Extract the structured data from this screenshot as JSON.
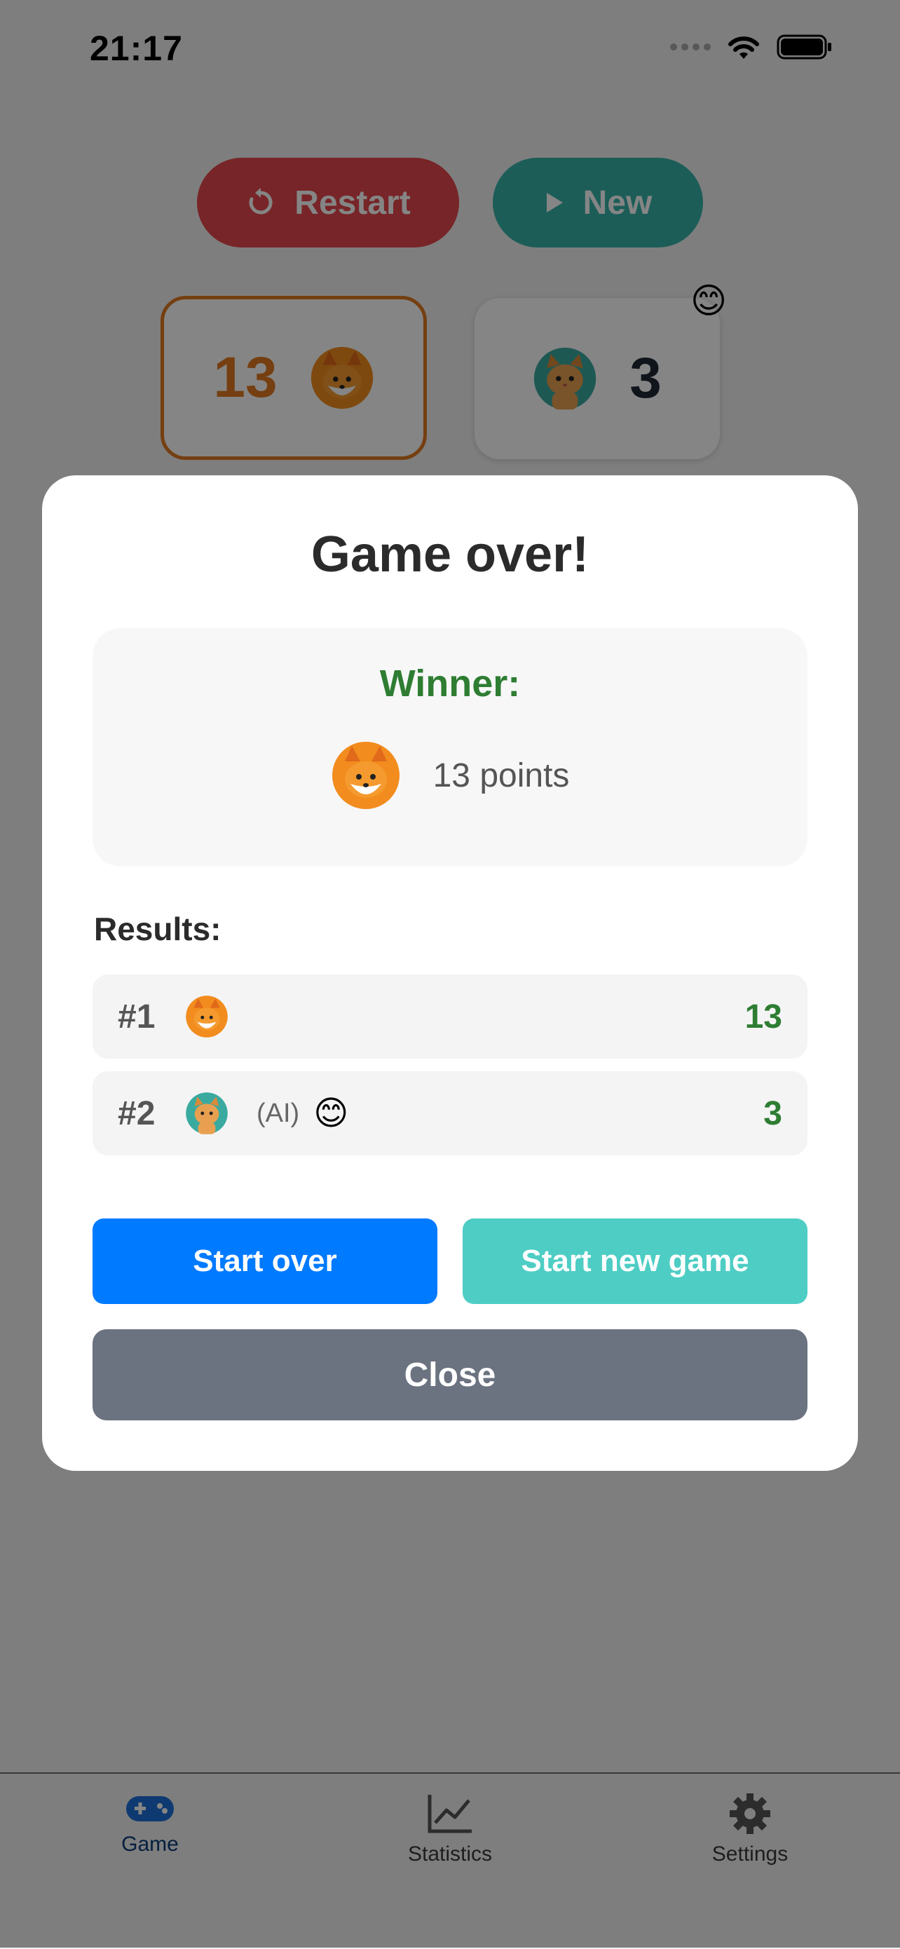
{
  "status_bar": {
    "time": "21:17"
  },
  "toolbar": {
    "restart_label": "Restart",
    "new_label": "New"
  },
  "scoreboard": {
    "player1": {
      "score": "13",
      "avatar": "fox-avatar"
    },
    "player2": {
      "score": "3",
      "avatar": "cat-avatar",
      "mood_emoji": "😊"
    }
  },
  "modal": {
    "title": "Game over!",
    "winner_label": "Winner:",
    "winner_points": "13 points",
    "results_label": "Results:",
    "results": [
      {
        "rank": "#1",
        "avatar": "fox-avatar",
        "ai": "",
        "emoji": "",
        "score": "13"
      },
      {
        "rank": "#2",
        "avatar": "cat-avatar",
        "ai": "(AI)",
        "emoji": "😊",
        "score": "3"
      }
    ],
    "start_over_label": "Start over",
    "start_new_label": "Start new game",
    "close_label": "Close"
  },
  "tabs": [
    {
      "label": "Game",
      "icon": "gamepad-icon",
      "active": true
    },
    {
      "label": "Statistics",
      "icon": "chart-icon",
      "active": false
    },
    {
      "label": "Settings",
      "icon": "gear-icon",
      "active": false
    }
  ],
  "colors": {
    "accent_blue": "#007aff",
    "teal": "#4ecdc4",
    "restart_red": "#e5484d",
    "winner_green": "#2e7d32",
    "player1_orange": "#e07a22"
  }
}
